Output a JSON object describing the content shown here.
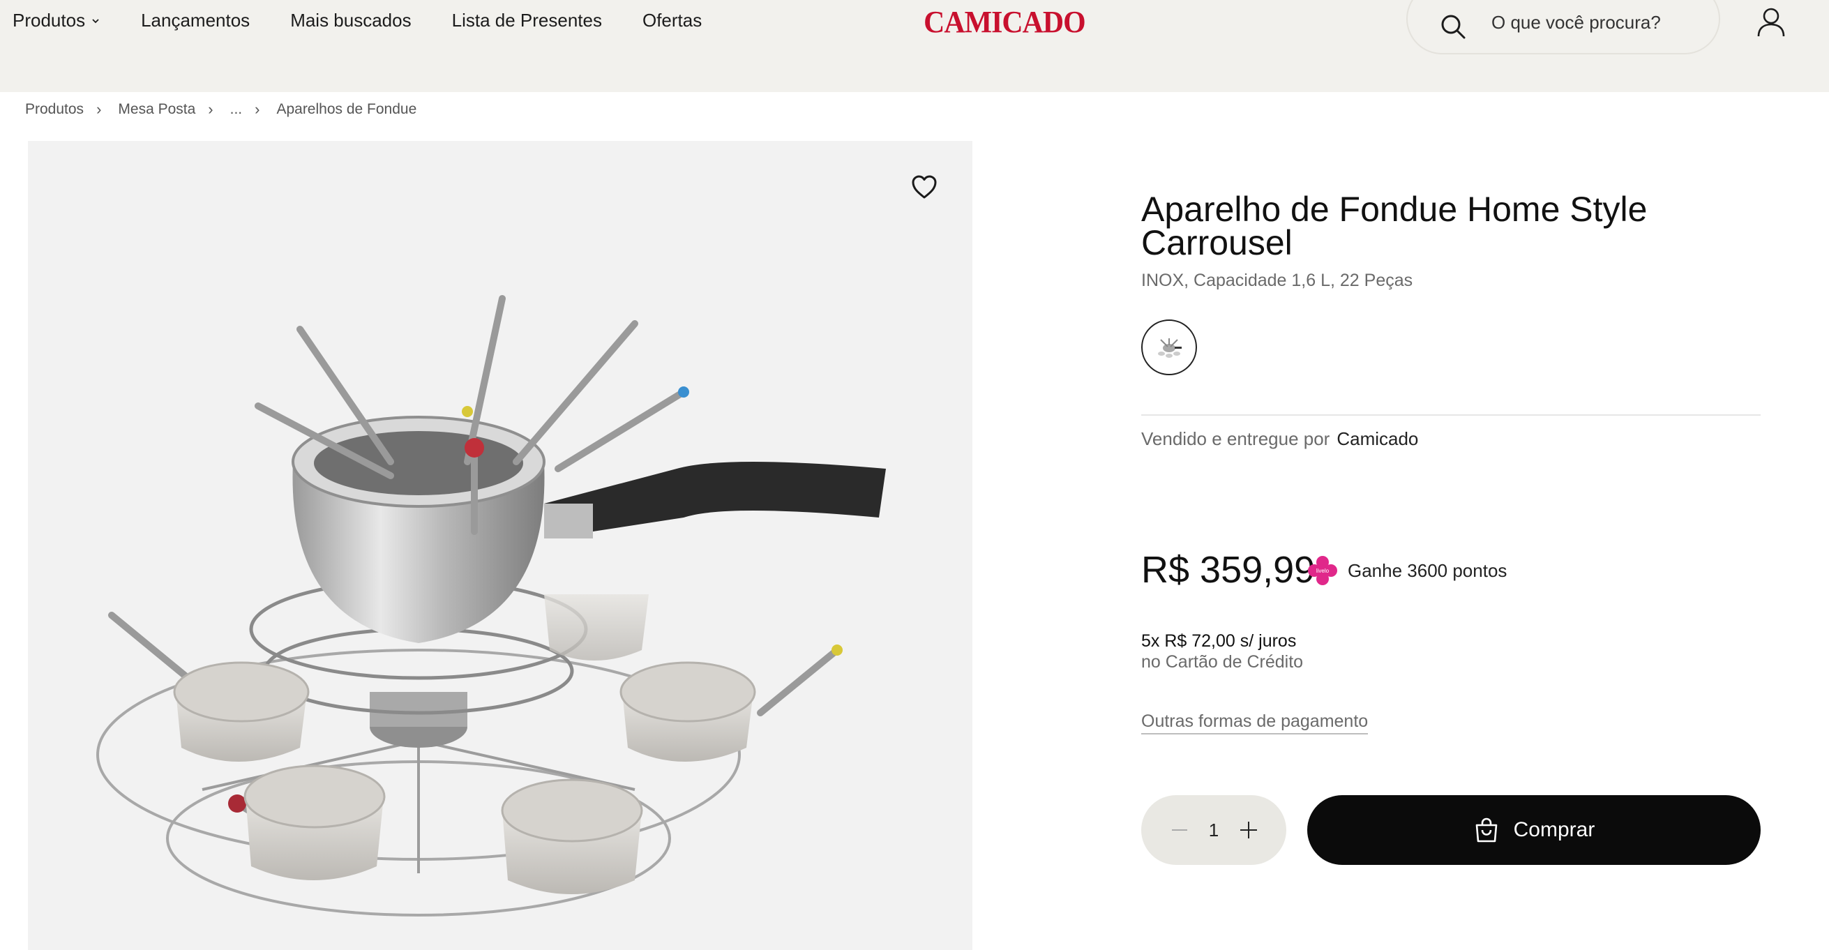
{
  "header": {
    "nav": [
      {
        "label": "Produtos",
        "has_dropdown": true
      },
      {
        "label": "Lançamentos"
      },
      {
        "label": "Mais buscados"
      },
      {
        "label": "Lista de Presentes"
      },
      {
        "label": "Ofertas"
      }
    ],
    "logo": "CAMICADO",
    "search": {
      "placeholder": "O que você procura?"
    },
    "icons": {
      "search": "search-icon",
      "user": "user-icon"
    }
  },
  "breadcrumb": [
    "Produtos",
    "Mesa Posta",
    "...",
    "Aparelhos de Fondue"
  ],
  "product": {
    "title": "Aparelho de Fondue Home Style Carrousel",
    "subtitle": "INOX, Capacidade 1,6 L, 22 Peças",
    "seller_label": "Vendido e entregue por",
    "seller_name": "Camicado",
    "price": "R$ 359,99",
    "points_label": "Ganhe 3600 pontos",
    "points_brand": "livelo",
    "installments": "5x R$ 72,00 s/ juros",
    "installments_method": "no Cartão de Crédito",
    "other_payments": "Outras formas de pagamento",
    "quantity": "1",
    "buy_label": "Comprar"
  },
  "colors": {
    "header_bg": "#f2f1ed",
    "logo_red": "#c8102e",
    "livelo_pink": "#e0288a",
    "buy_button": "#0b0b0b",
    "image_bg": "#f2f2f2"
  }
}
